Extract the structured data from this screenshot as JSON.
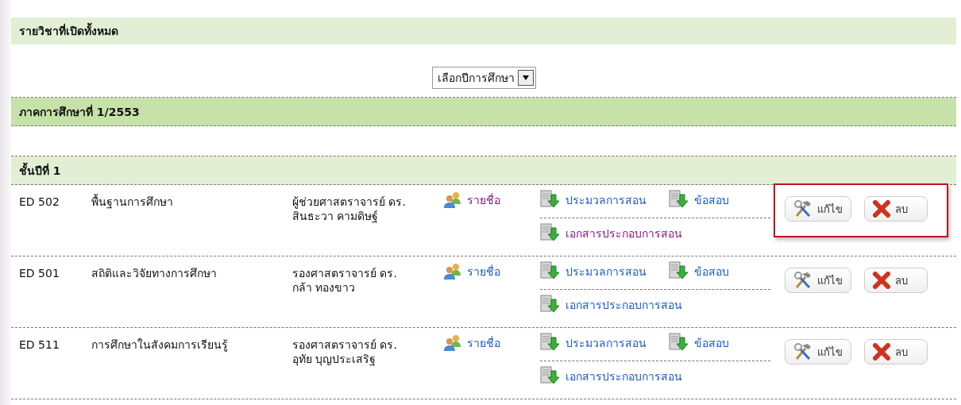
{
  "page_title": "รายวิชาที่เปิดทั้งหมด",
  "year_select": {
    "value": "เลือกปีการศึกษา"
  },
  "semester": "ภาคการศึกษาที่ 1/2553",
  "class_year": "ชั้นปีที่ 1",
  "courses": [
    {
      "code": "ED 502",
      "title": "พื้นฐานการศึกษา",
      "teacher": "ผู้ช่วยศาสตราจารย์ ดร.\nสินธะวา คามดิษฐ์",
      "highlighted": true,
      "names_link": {
        "label": "รายชื่อ",
        "visited": true
      },
      "syllabus_link": {
        "label": "ประมวลการสอน",
        "visited": false
      },
      "exam_link": {
        "label": "ข้อสอบ",
        "visited": false
      },
      "docs_link": {
        "label": "เอกสารประกอบการสอน",
        "visited": true
      },
      "edit_button": "แก้ไข",
      "delete_button": "ลบ"
    },
    {
      "code": "ED 501",
      "title": "สถิติและวิจัยทางการศึกษา",
      "teacher": "รองศาสตราจารย์ ดร.\nกล้า ทองขาว",
      "highlighted": false,
      "names_link": {
        "label": "รายชื่อ",
        "visited": false
      },
      "syllabus_link": {
        "label": "ประมวลการสอน",
        "visited": false
      },
      "exam_link": {
        "label": "ข้อสอบ",
        "visited": false
      },
      "docs_link": {
        "label": "เอกสารประกอบการสอน",
        "visited": false
      },
      "edit_button": "แก้ไข",
      "delete_button": "ลบ"
    },
    {
      "code": "ED 511",
      "title": "การศึกษาในสังคมการเรียนรู้",
      "teacher": "รองศาสตราจารย์ ดร.\nอุทัย บุญประเสริฐ",
      "highlighted": false,
      "names_link": {
        "label": "รายชื่อ",
        "visited": false
      },
      "syllabus_link": {
        "label": "ประมวลการสอน",
        "visited": false
      },
      "exam_link": {
        "label": "ข้อสอบ",
        "visited": false
      },
      "docs_link": {
        "label": "เอกสารประกอบการสอน",
        "visited": false
      },
      "edit_button": "แก้ไข",
      "delete_button": "ลบ"
    }
  ]
}
